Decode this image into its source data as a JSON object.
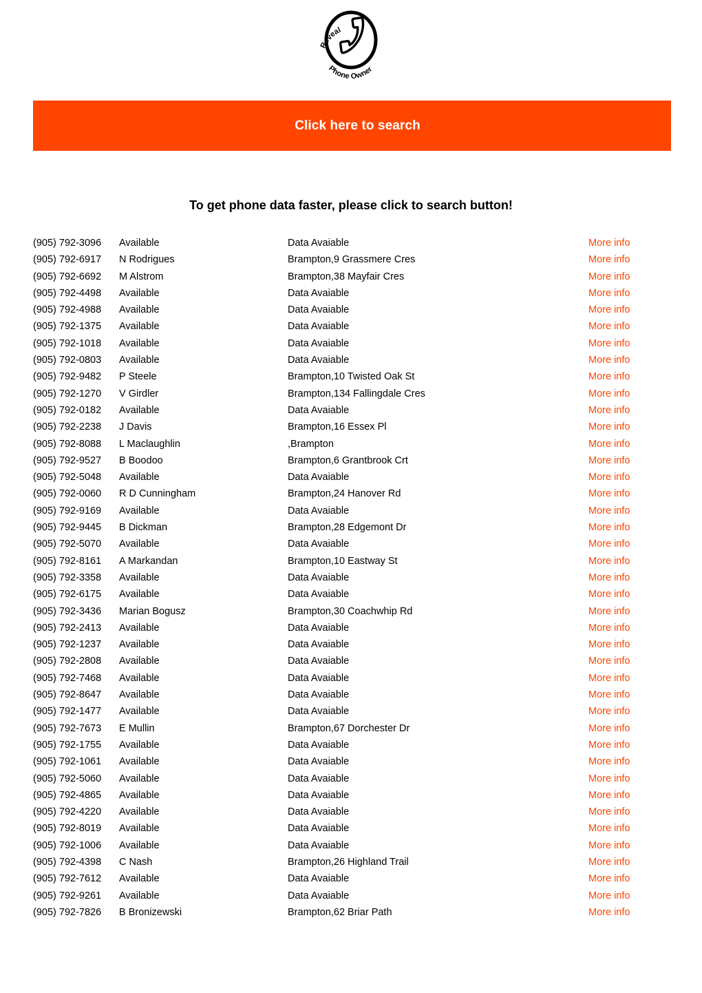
{
  "logo": {
    "alt": "Reveal Phone Owner",
    "curved_text_top": "Reveal",
    "curved_text_bottom": "Phone Owner",
    "icon": "phone-handset-icon"
  },
  "banner": {
    "label": "Click here to search",
    "background_color": "#FF4500",
    "text_color": "#FFFFFF"
  },
  "tagline": "To get phone data faster, please click to search button!",
  "results": {
    "link_label": "More info",
    "link_color": "#FF4500",
    "placeholder_name": "Available",
    "placeholder_address": "Data Avaiable",
    "rows": [
      {
        "phone": "(905) 792-3096",
        "name": "Available",
        "address": "Data Avaiable",
        "link": "More info"
      },
      {
        "phone": "(905) 792-6917",
        "name": "N Rodrigues",
        "address": "Brampton,9 Grassmere Cres",
        "link": "More info"
      },
      {
        "phone": "(905) 792-6692",
        "name": "M Alstrom",
        "address": "Brampton,38 Mayfair Cres",
        "link": "More info"
      },
      {
        "phone": "(905) 792-4498",
        "name": "Available",
        "address": "Data Avaiable",
        "link": "More info"
      },
      {
        "phone": "(905) 792-4988",
        "name": "Available",
        "address": "Data Avaiable",
        "link": "More info"
      },
      {
        "phone": "(905) 792-1375",
        "name": "Available",
        "address": "Data Avaiable",
        "link": "More info"
      },
      {
        "phone": "(905) 792-1018",
        "name": "Available",
        "address": "Data Avaiable",
        "link": "More info"
      },
      {
        "phone": "(905) 792-0803",
        "name": "Available",
        "address": "Data Avaiable",
        "link": "More info"
      },
      {
        "phone": "(905) 792-9482",
        "name": "P Steele",
        "address": "Brampton,10 Twisted Oak St",
        "link": "More info"
      },
      {
        "phone": "(905) 792-1270",
        "name": "V Girdler",
        "address": "Brampton,134 Fallingdale Cres",
        "link": "More info"
      },
      {
        "phone": "(905) 792-0182",
        "name": "Available",
        "address": "Data Avaiable",
        "link": "More info"
      },
      {
        "phone": "(905) 792-2238",
        "name": "J Davis",
        "address": "Brampton,16 Essex Pl",
        "link": "More info"
      },
      {
        "phone": "(905) 792-8088",
        "name": "L Maclaughlin",
        "address": ",Brampton",
        "link": "More info"
      },
      {
        "phone": "(905) 792-9527",
        "name": "B Boodoo",
        "address": "Brampton,6 Grantbrook Crt",
        "link": "More info"
      },
      {
        "phone": "(905) 792-5048",
        "name": "Available",
        "address": "Data Avaiable",
        "link": "More info"
      },
      {
        "phone": "(905) 792-0060",
        "name": "R D Cunningham",
        "address": "Brampton,24 Hanover Rd",
        "link": "More info"
      },
      {
        "phone": "(905) 792-9169",
        "name": "Available",
        "address": "Data Avaiable",
        "link": "More info"
      },
      {
        "phone": "(905) 792-9445",
        "name": "B Dickman",
        "address": "Brampton,28 Edgemont Dr",
        "link": "More info"
      },
      {
        "phone": "(905) 792-5070",
        "name": "Available",
        "address": "Data Avaiable",
        "link": "More info"
      },
      {
        "phone": "(905) 792-8161",
        "name": "A Markandan",
        "address": "Brampton,10 Eastway St",
        "link": "More info"
      },
      {
        "phone": "(905) 792-3358",
        "name": "Available",
        "address": "Data Avaiable",
        "link": "More info"
      },
      {
        "phone": "(905) 792-6175",
        "name": "Available",
        "address": "Data Avaiable",
        "link": "More info"
      },
      {
        "phone": "(905) 792-3436",
        "name": "Marian Bogusz",
        "address": "Brampton,30 Coachwhip Rd",
        "link": "More info"
      },
      {
        "phone": "(905) 792-2413",
        "name": "Available",
        "address": "Data Avaiable",
        "link": "More info"
      },
      {
        "phone": "(905) 792-1237",
        "name": "Available",
        "address": "Data Avaiable",
        "link": "More info"
      },
      {
        "phone": "(905) 792-2808",
        "name": "Available",
        "address": "Data Avaiable",
        "link": "More info"
      },
      {
        "phone": "(905) 792-7468",
        "name": "Available",
        "address": "Data Avaiable",
        "link": "More info"
      },
      {
        "phone": "(905) 792-8647",
        "name": "Available",
        "address": "Data Avaiable",
        "link": "More info"
      },
      {
        "phone": "(905) 792-1477",
        "name": "Available",
        "address": "Data Avaiable",
        "link": "More info"
      },
      {
        "phone": "(905) 792-7673",
        "name": "E Mullin",
        "address": "Brampton,67 Dorchester Dr",
        "link": "More info"
      },
      {
        "phone": "(905) 792-1755",
        "name": "Available",
        "address": "Data Avaiable",
        "link": "More info"
      },
      {
        "phone": "(905) 792-1061",
        "name": "Available",
        "address": "Data Avaiable",
        "link": "More info"
      },
      {
        "phone": "(905) 792-5060",
        "name": "Available",
        "address": "Data Avaiable",
        "link": "More info"
      },
      {
        "phone": "(905) 792-4865",
        "name": "Available",
        "address": "Data Avaiable",
        "link": "More info"
      },
      {
        "phone": "(905) 792-4220",
        "name": "Available",
        "address": "Data Avaiable",
        "link": "More info"
      },
      {
        "phone": "(905) 792-8019",
        "name": "Available",
        "address": "Data Avaiable",
        "link": "More info"
      },
      {
        "phone": "(905) 792-1006",
        "name": "Available",
        "address": "Data Avaiable",
        "link": "More info"
      },
      {
        "phone": "(905) 792-4398",
        "name": "C Nash",
        "address": "Brampton,26 Highland Trail",
        "link": "More info"
      },
      {
        "phone": "(905) 792-7612",
        "name": "Available",
        "address": "Data Avaiable",
        "link": "More info"
      },
      {
        "phone": "(905) 792-9261",
        "name": "Available",
        "address": "Data Avaiable",
        "link": "More info"
      },
      {
        "phone": "(905) 792-7826",
        "name": "B Bronizewski",
        "address": "Brampton,62 Briar Path",
        "link": "More info"
      }
    ]
  }
}
